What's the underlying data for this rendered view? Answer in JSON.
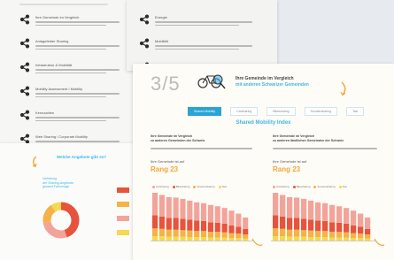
{
  "left_page": {
    "items": [
      "Ihre Gemeinde im Vergleich",
      "Anlagefelder Sharing",
      "Infrastruktur & Mobilität",
      "Mobility Assessment / Mobility",
      "Kennzahlen",
      "Web Sharing / Corporate Mobility"
    ]
  },
  "mid_page": {
    "items": [
      "Energie",
      "Mobilität",
      "Fazit"
    ]
  },
  "main_page": {
    "step": "3/5",
    "header_title": "Ihre Gemeinde im Vergleich",
    "header_subtitle": "mit anderen Schweizer Gemeinden",
    "tabs": [
      "Shared Mobility",
      "Carsharing",
      "Bikesharing",
      "Scootersharing",
      "Taxi"
    ],
    "active_tab": 0,
    "section_title": "Shared Mobility Index",
    "left_chart": {
      "heading_line1": "Ihre Gemeinde im Vergleich",
      "heading_line2": "zu anderen Gemeinden der Schweiz",
      "rank_label": "Ihre Gemeinde ist auf",
      "rank_value": "Rang 23"
    },
    "right_chart": {
      "heading_line1": "Ihre Gemeinde im Vergleich",
      "heading_line2": "zu anderen ländlichen Gemeinden der Schweiz",
      "rank_label": "Ihre Gemeinde ist auf",
      "rank_value": "Rang 23"
    },
    "legend": [
      "Carsharing",
      "Bikesharing",
      "Scootersharing",
      "Taxi"
    ]
  },
  "bottom_left": {
    "title": "Welche Angebote gibt es?",
    "side_text_line1": "Verteilung",
    "side_text_line2": "der Sharing-Angebote",
    "side_text_line3": "gesamt Fahrzeuge"
  },
  "chart_data": {
    "type": "bar",
    "series": [
      {
        "name": "Carsharing",
        "values": [
          52,
          50,
          48,
          47,
          46,
          44,
          42,
          41,
          40,
          38,
          36,
          34,
          30,
          26
        ]
      },
      {
        "name": "Bikesharing",
        "values": [
          30,
          28,
          27,
          27,
          26,
          25,
          24,
          23,
          22,
          21,
          20,
          18,
          16,
          13
        ]
      },
      {
        "name": "Scootersharing",
        "values": [
          18,
          17,
          16,
          16,
          15,
          15,
          14,
          14,
          13,
          13,
          12,
          11,
          10,
          9
        ]
      },
      {
        "name": "Taxi",
        "values": [
          10,
          10,
          9,
          9,
          9,
          8,
          8,
          8,
          7,
          7,
          7,
          6,
          6,
          5
        ]
      }
    ],
    "colors": {
      "Carsharing": "#f3a49a",
      "Bikesharing": "#e8533c",
      "Scootersharing": "#f4b247",
      "Taxi": "#f7d84e"
    }
  },
  "colors": {
    "accent_blue": "#2aa3d6",
    "accent_orange": "#f3a63a"
  }
}
